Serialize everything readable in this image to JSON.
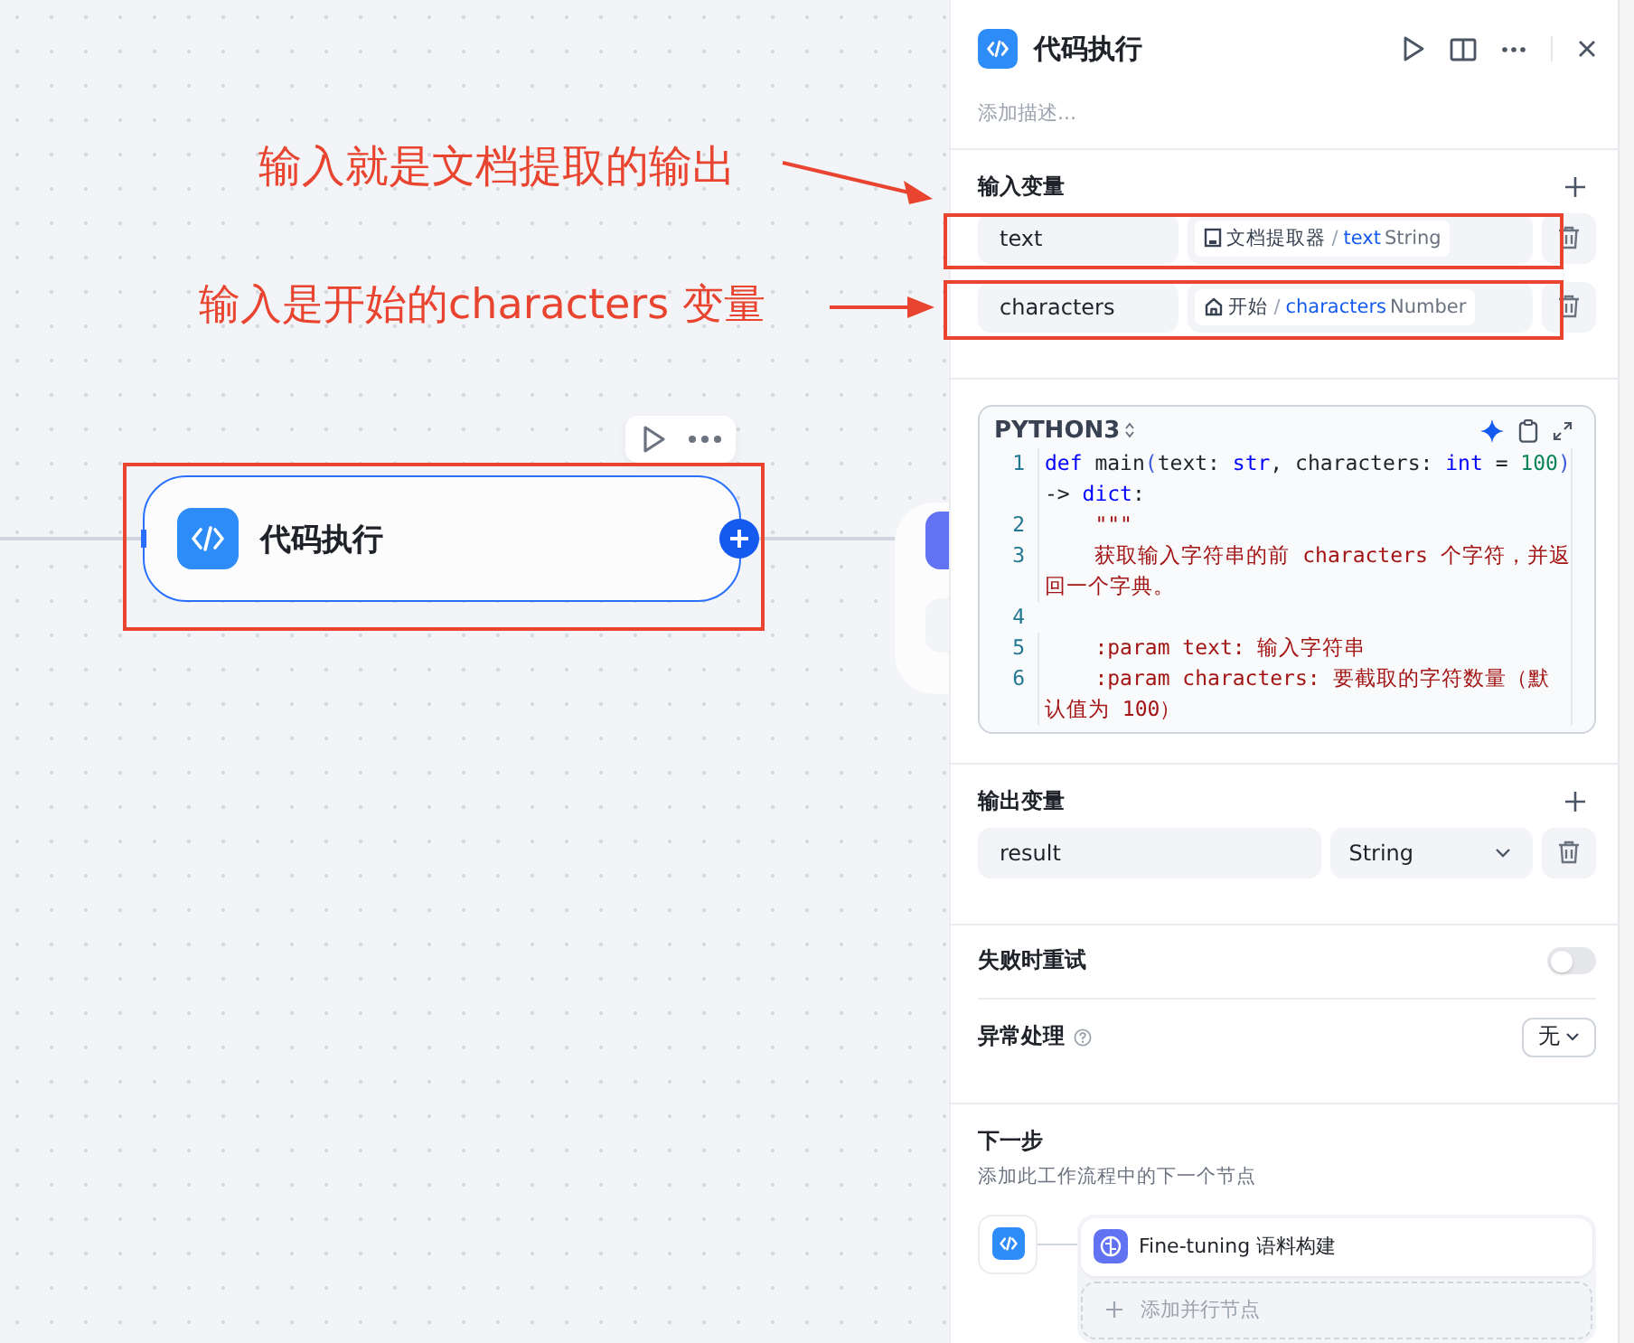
{
  "canvas": {
    "node": {
      "title": "代码执行",
      "selected": true
    },
    "annotations": [
      {
        "text": "输入就是文档提取的输出"
      },
      {
        "text": "输入是开始的characters 变量"
      }
    ]
  },
  "panel": {
    "title": "代码执行",
    "description": {
      "placeholder": "添加描述..."
    },
    "inputs": {
      "label": "输入变量",
      "rows": [
        {
          "name": "text",
          "kind": "doc",
          "source": "文档提取器",
          "separator": "/",
          "variable": "text",
          "type": "String"
        },
        {
          "name": "characters",
          "kind": "home",
          "source": "开始",
          "separator": "/",
          "variable": "characters",
          "type": "Number"
        }
      ]
    },
    "code": {
      "language": "PYTHON3",
      "lines": [
        {
          "number": "1",
          "tokens": [
            {
              "t": "def",
              "kind": "kw"
            },
            {
              "t": " main",
              "kind": "plain"
            },
            {
              "t": "(",
              "kind": "bracket"
            },
            {
              "t": "text: ",
              "kind": "plain"
            },
            {
              "t": "str",
              "kind": "kw"
            },
            {
              "t": ", characters: ",
              "kind": "plain"
            },
            {
              "t": "int",
              "kind": "kw"
            },
            {
              "t": " = ",
              "kind": "plain"
            },
            {
              "t": "100",
              "kind": "num"
            },
            {
              "t": ")",
              "kind": "bracket"
            },
            {
              "t": " -> ",
              "kind": "plain"
            },
            {
              "t": "dict",
              "kind": "kw"
            },
            {
              "t": ":",
              "kind": "plain"
            }
          ]
        },
        {
          "number": "2",
          "tokens": [
            {
              "t": "    \"\"\"",
              "kind": "str"
            }
          ]
        },
        {
          "number": "3",
          "tokens": [
            {
              "t": "    获取输入字符串的前 characters 个字符，并返回一个字典。",
              "kind": "str"
            }
          ]
        },
        {
          "number": "4"
        },
        {
          "number": "5",
          "tokens": [
            {
              "t": "    :param text: 输入字符串",
              "kind": "str"
            }
          ]
        },
        {
          "number": "6",
          "tokens": [
            {
              "t": "    :param characters: 要截取的字符数量（默认值为 100）",
              "kind": "str"
            }
          ]
        }
      ]
    },
    "outputs": {
      "label": "输出变量",
      "rows": [
        {
          "name": "result",
          "type": "String"
        }
      ]
    },
    "retry": {
      "label": "失败时重试",
      "on": false
    },
    "error_handling": {
      "label": "异常处理",
      "value": "无"
    },
    "next": {
      "title": "下一步",
      "description": "添加此工作流程中的下一个节点",
      "nodes": [
        {
          "title": "Fine-tuning 语料构建"
        }
      ],
      "add_label": "添加并行节点"
    }
  }
}
